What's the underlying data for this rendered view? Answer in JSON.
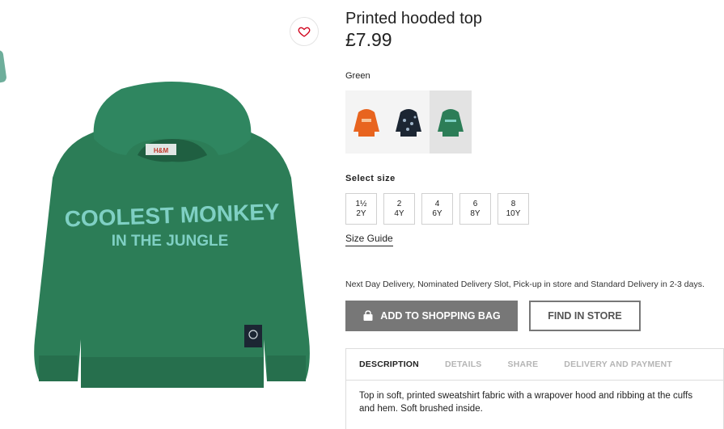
{
  "product": {
    "title": "Printed hooded top",
    "price": "£7.99",
    "print_line1": "COOLEST MONKEY",
    "print_line2": "IN THE JUNGLE",
    "neck_label": "H&M"
  },
  "colors": {
    "selected_name": "Green",
    "swatches": [
      {
        "name": "orange",
        "hex": "#e8641f"
      },
      {
        "name": "navy-print",
        "hex": "#1c2633"
      },
      {
        "name": "green",
        "hex": "#2e7d5a"
      }
    ]
  },
  "sizes": {
    "label": "Select size",
    "options": [
      {
        "top": "1½",
        "bottom": "2Y"
      },
      {
        "top": "2",
        "bottom": "4Y"
      },
      {
        "top": "4",
        "bottom": "6Y"
      },
      {
        "top": "6",
        "bottom": "8Y"
      },
      {
        "top": "8",
        "bottom": "10Y"
      }
    ],
    "guide_link": "Size Guide"
  },
  "delivery_note": "Next Day Delivery, Nominated Delivery Slot, Pick-up in store and Standard Delivery in 2-3 days.",
  "actions": {
    "add_to_bag": "ADD TO SHOPPING BAG",
    "find_in_store": "FIND IN STORE"
  },
  "info": {
    "tabs": [
      "DESCRIPTION",
      "DETAILS",
      "SHARE",
      "DELIVERY AND PAYMENT"
    ],
    "description": "Top in soft, printed sweatshirt fabric with a wrapover hood and ribbing at the cuffs and hem. Soft brushed inside."
  },
  "theme": {
    "hoodie_green": "#2c7d57",
    "print_color": "#7fd0c4",
    "button_gray": "#777777",
    "heart_red": "#d0021b"
  }
}
